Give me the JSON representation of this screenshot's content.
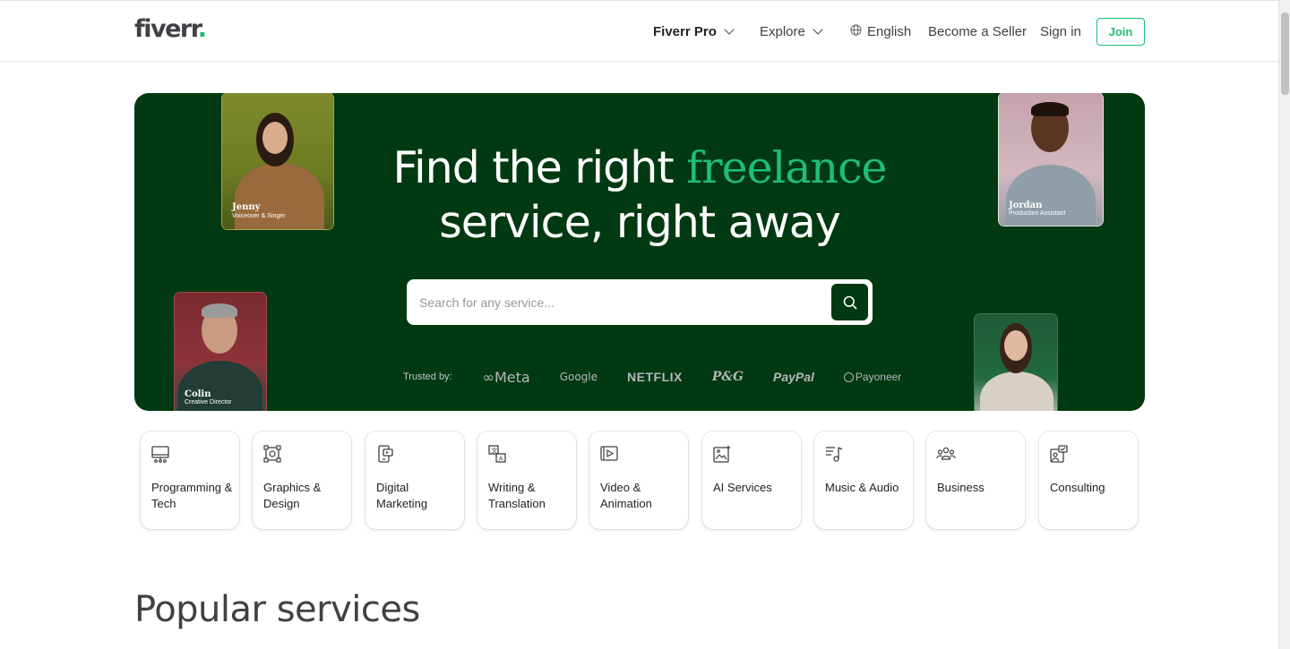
{
  "header": {
    "logo_text": "fiverr",
    "logo_dot": ".",
    "nav": {
      "fiverr_pro": "Fiverr Pro",
      "explore": "Explore",
      "language": "English",
      "become_seller": "Become a Seller",
      "sign_in": "Sign in",
      "join": "Join"
    }
  },
  "hero": {
    "title_part1": "Find the right ",
    "title_accent": "freelance",
    "title_part2": "service, right away",
    "search": {
      "placeholder": "Search for any service..."
    },
    "trusted_label": "Trusted by:",
    "brands": {
      "meta": "Meta",
      "google": "Google",
      "netflix": "NETFLIX",
      "pg": "P&G",
      "paypal": "PayPal",
      "payoneer": "Payoneer"
    },
    "portraits": {
      "jenny": {
        "name": "Jenny",
        "role": "Voiceover & Singer"
      },
      "jordan": {
        "name": "Jordan",
        "role": "Production Assistant"
      },
      "colin": {
        "name": "Colin",
        "role": "Creative Director"
      }
    }
  },
  "categories": [
    {
      "label": "Programming & Tech",
      "icon": "monitor-icon"
    },
    {
      "label": "Graphics & Design",
      "icon": "design-frame-icon"
    },
    {
      "label": "Digital Marketing",
      "icon": "marketing-device-icon"
    },
    {
      "label": "Writing & Translation",
      "icon": "translation-icon"
    },
    {
      "label": "Video & Animation",
      "icon": "video-play-icon"
    },
    {
      "label": "AI Services",
      "icon": "ai-image-icon"
    },
    {
      "label": "Music & Audio",
      "icon": "music-note-icon"
    },
    {
      "label": "Business",
      "icon": "people-group-icon"
    },
    {
      "label": "Consulting",
      "icon": "consulting-icon"
    }
  ],
  "popular_heading": "Popular services",
  "colors": {
    "brand_green": "#1dbf73",
    "hero_bg": "#013912",
    "text_dark": "#222325"
  }
}
